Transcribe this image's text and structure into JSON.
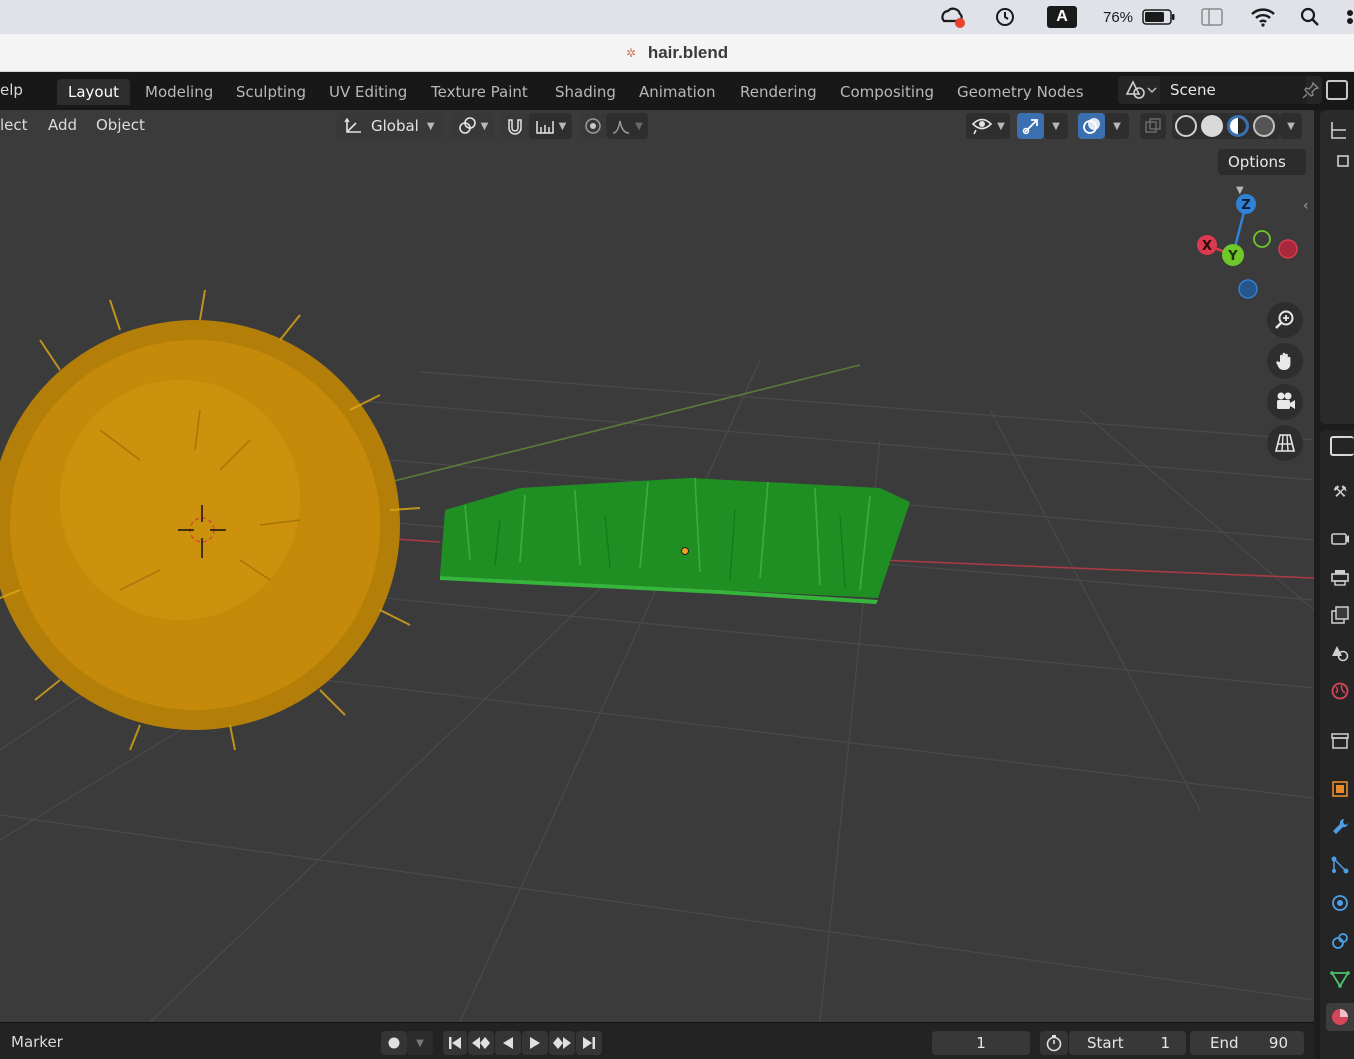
{
  "window": {
    "title": "hair.blend"
  },
  "mac_menubar": {
    "battery_percent": "76%",
    "input_source": "A"
  },
  "topbar": {
    "menu_help": "elp",
    "workspace_tabs": [
      {
        "label": "Layout",
        "active": true
      },
      {
        "label": "Modeling"
      },
      {
        "label": "Sculpting"
      },
      {
        "label": "UV Editing"
      },
      {
        "label": "Texture Paint"
      },
      {
        "label": "Shading"
      },
      {
        "label": "Animation"
      },
      {
        "label": "Rendering"
      },
      {
        "label": "Compositing"
      },
      {
        "label": "Geometry Nodes"
      }
    ],
    "scene_name": "Scene"
  },
  "viewport_header": {
    "menus": [
      "lect",
      "Add",
      "Object"
    ],
    "transform_orientation": "Global",
    "options_label": "Options"
  },
  "gizmo": {
    "axes": [
      "Z",
      "X",
      "Y"
    ]
  },
  "scene_objects": [
    {
      "name": "hair-ball",
      "color": "#c58a0a"
    },
    {
      "name": "grass-patch",
      "color": "#1f8f24"
    }
  ],
  "timeline": {
    "marker_label": "Marker",
    "current_frame": "1",
    "start_label": "Start",
    "start_value": "1",
    "end_label": "End",
    "end_value": "90"
  }
}
